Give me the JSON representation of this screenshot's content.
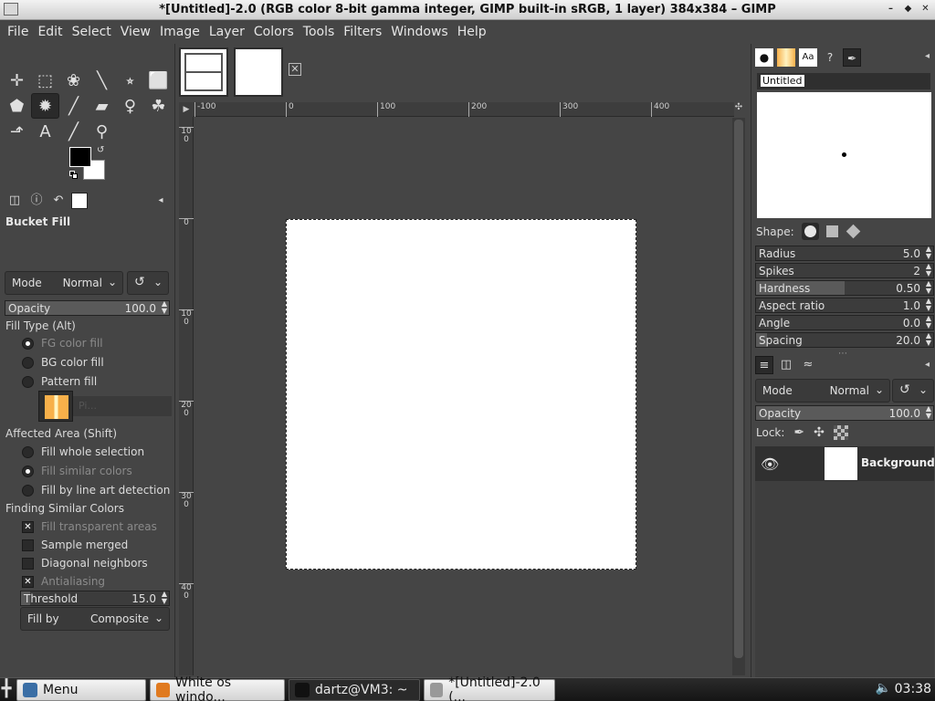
{
  "window": {
    "title": "*[Untitled]-2.0 (RGB color 8-bit gamma integer, GIMP built-in sRGB, 1 layer) 384x384 – GIMP",
    "controls": [
      "–",
      "◆",
      "✕"
    ]
  },
  "menu": [
    "File",
    "Edit",
    "Select",
    "View",
    "Image",
    "Layer",
    "Colors",
    "Tools",
    "Filters",
    "Windows",
    "Help"
  ],
  "toolbox": {
    "tools": [
      {
        "name": "move-tool-icon",
        "glyph": "✛"
      },
      {
        "name": "rect-select-tool-icon",
        "glyph": "⬚"
      },
      {
        "name": "free-select-tool-icon",
        "glyph": "❀"
      },
      {
        "name": "fuzzy-select-tool-icon",
        "glyph": "╲"
      },
      {
        "name": "crop-tool-icon",
        "glyph": "⭒"
      },
      {
        "name": "transform-tool-icon",
        "glyph": "⬜"
      },
      {
        "name": "warp-tool-icon",
        "glyph": "⬟"
      },
      {
        "name": "bucket-fill-tool-icon",
        "glyph": "✹",
        "active": true
      },
      {
        "name": "paintbrush-tool-icon",
        "glyph": "╱"
      },
      {
        "name": "eraser-tool-icon",
        "glyph": "▰"
      },
      {
        "name": "clone-tool-icon",
        "glyph": "♀"
      },
      {
        "name": "smudge-tool-icon",
        "glyph": "☘"
      },
      {
        "name": "paths-tool-icon",
        "glyph": "⬏"
      },
      {
        "name": "text-tool-icon",
        "glyph": "A"
      },
      {
        "name": "color-picker-tool-icon",
        "glyph": "╱"
      },
      {
        "name": "zoom-tool-icon",
        "glyph": "⚲"
      }
    ],
    "fg_color": "#000000",
    "bg_color": "#ffffff"
  },
  "tool_options": {
    "title": "Bucket Fill",
    "mode_label": "Mode",
    "mode_value": "Normal",
    "opacity_label": "Opacity",
    "opacity_value": "100.0",
    "opacity_fraction": 1.0,
    "fill_type_label": "Fill Type  (Alt)",
    "fill_types": [
      {
        "label": "FG color fill",
        "selected": true,
        "dim": true
      },
      {
        "label": "BG color fill",
        "selected": false,
        "dim": false
      },
      {
        "label": "Pattern fill",
        "selected": false,
        "dim": false
      }
    ],
    "pattern_name": "Pi...",
    "affected_area_label": "Affected Area  (Shift)",
    "affected_areas": [
      {
        "label": "Fill whole selection",
        "selected": false,
        "dim": false
      },
      {
        "label": "Fill similar colors",
        "selected": true,
        "dim": true
      },
      {
        "label": "Fill by line art detection",
        "selected": false,
        "dim": false
      }
    ],
    "similar_label": "Finding Similar Colors",
    "similar_options": [
      {
        "label": "Fill transparent areas",
        "checked": true,
        "dim": true
      },
      {
        "label": "Sample merged",
        "checked": false,
        "dim": false
      },
      {
        "label": "Diagonal neighbors",
        "checked": false,
        "dim": false
      },
      {
        "label": "Antialiasing",
        "checked": true,
        "dim": true
      }
    ],
    "threshold_label": "Threshold",
    "threshold_value": "15.0",
    "threshold_fraction": 0.06,
    "fill_by_label": "Fill by",
    "fill_by_value": "Composite"
  },
  "canvas": {
    "ruler_h": [
      "-100",
      "0",
      "100",
      "200",
      "300",
      "400"
    ],
    "ruler_v": [
      "100",
      "0",
      "100",
      "200",
      "300",
      "400"
    ],
    "ruler_h_values": [
      -100,
      0,
      100,
      200,
      300,
      400
    ],
    "ruler_v_values": [
      -100,
      0,
      100,
      200,
      300,
      400
    ]
  },
  "brushes": {
    "brush_name": "Untitled",
    "shape_label": "Shape:",
    "params": [
      {
        "label": "Radius",
        "value": "5.0",
        "fraction": 0.0
      },
      {
        "label": "Spikes",
        "value": "2",
        "fraction": 0.0
      },
      {
        "label": "Hardness",
        "value": "0.50",
        "fraction": 0.5
      },
      {
        "label": "Aspect ratio",
        "value": "1.0",
        "fraction": 0.0
      },
      {
        "label": "Angle",
        "value": "0.0",
        "fraction": 0.0
      },
      {
        "label": "Spacing",
        "value": "20.0",
        "fraction": 0.06
      }
    ]
  },
  "layers": {
    "mode_label": "Mode",
    "mode_value": "Normal",
    "opacity_label": "Opacity",
    "opacity_value": "100.0",
    "opacity_fraction": 1.0,
    "lock_label": "Lock:",
    "items": [
      {
        "name": "Background",
        "visible": true
      }
    ]
  },
  "taskbar": {
    "items": [
      {
        "label": "Menu",
        "style": "light",
        "icon_color": "#3a6ea5"
      },
      {
        "label": "White os windo...",
        "style": "light",
        "icon_color": "#e07a1f"
      },
      {
        "label": "dartz@VM3: ~",
        "style": "dark",
        "icon_color": "#111111"
      },
      {
        "label": "*[Untitled]-2.0 (...",
        "style": "light",
        "icon_color": "#999999"
      }
    ],
    "clock": "03:38"
  }
}
